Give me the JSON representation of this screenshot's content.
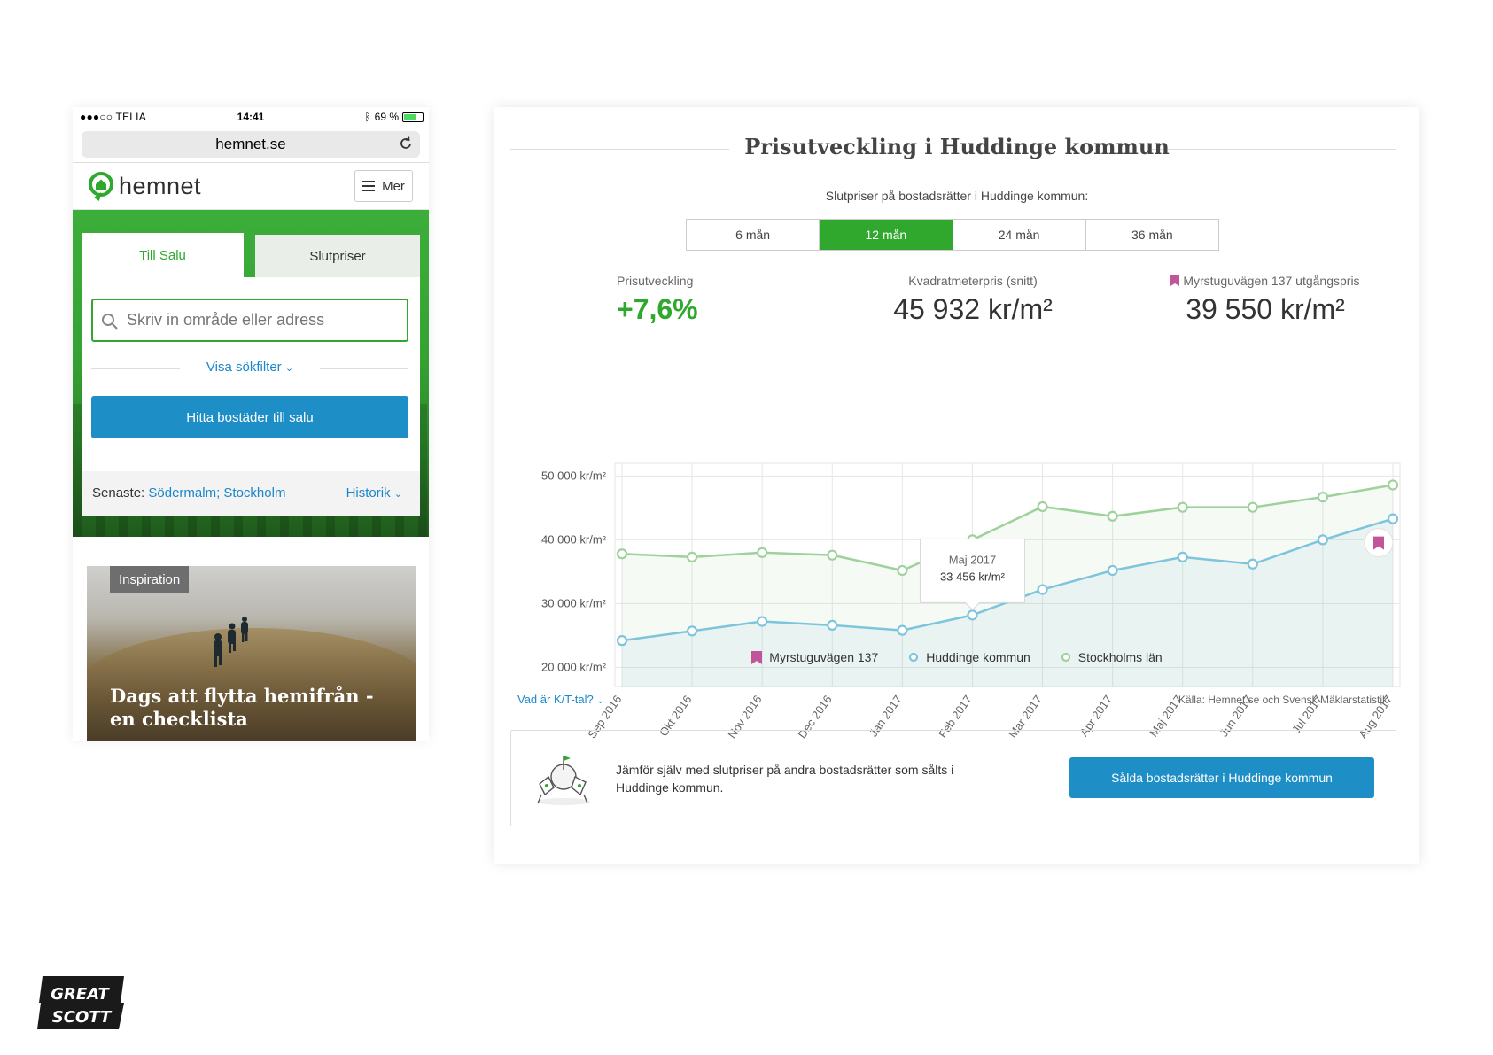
{
  "phone": {
    "status": {
      "carrier": "●●●○○ TELIA",
      "time": "14:41",
      "battery": "69 %",
      "battery_level": 0.69
    },
    "url": "hemnet.se",
    "logo_text": "hemnet",
    "menu_label": "Mer",
    "tabs": [
      {
        "label": "Till Salu"
      },
      {
        "label": "Slutpriser"
      }
    ],
    "search_placeholder": "Skriv in område eller adress",
    "filter_link": "Visa sökfilter",
    "search_button": "Hitta bostäder till salu",
    "recent": {
      "label": "Senaste:",
      "places": "Södermalm; Stockholm",
      "history": "Historik"
    },
    "inspiration": {
      "tag": "Inspiration",
      "title": "Dags att flytta hemifrån - en checklista"
    }
  },
  "widget": {
    "title": "Prisutveckling i Huddinge kommun",
    "subtitle": "Slutpriser på bostadsrätter i Huddinge kommun:",
    "periods": [
      "6 mån",
      "12 mån",
      "24 mån",
      "36 mån"
    ],
    "active_period": "12 mån",
    "stats": {
      "change": {
        "label": "Prisutveckling",
        "value": "+7,6%"
      },
      "sqm": {
        "label": "Kvadratmeterpris (snitt)",
        "value": "45 932 kr/m²"
      },
      "listing": {
        "label": "Myrstuguvägen 137 utgångspris",
        "value": "39 550 kr/m²"
      }
    },
    "legend": [
      {
        "label": "Myrstuguvägen 137",
        "color": "#c2549a"
      },
      {
        "label": "Huddinge kommun",
        "color": "#7ec4dd"
      },
      {
        "label": "Stockholms län",
        "color": "#9ed29a"
      }
    ],
    "kt_link": "Vad är K/T-tal?",
    "source": "Källa: Hemnet.se och Svensk Mäklarstatistik",
    "compare_text": "Jämför själv med slutpriser på andra bostadsrätter som sålts i Huddinge kommun.",
    "compare_button": "Sålda bostadsrätter i Huddinge kommun"
  },
  "chart_data": {
    "type": "line",
    "categories": [
      "Sep 2016",
      "Okt 2016",
      "Nov 2016",
      "Dec 2016",
      "Jan 2017",
      "Feb 2017",
      "Mar 2017",
      "Apr 2017",
      "Maj 2017",
      "Jun 2017",
      "Jul 2017",
      "Aug 2017"
    ],
    "series": [
      {
        "name": "Huddinge kommun",
        "color": "#7ec4dd",
        "values": [
          24200,
          25700,
          27200,
          26600,
          25800,
          28200,
          32200,
          35200,
          37300,
          36200,
          40000,
          43300
        ]
      },
      {
        "name": "Stockholms län",
        "color": "#9ed29a",
        "values": [
          37800,
          37300,
          38000,
          37600,
          35200,
          40000,
          45200,
          43700,
          45100,
          45100,
          46700,
          48600
        ]
      }
    ],
    "listing_marker": {
      "name": "Myrstuguvägen 137",
      "value": 39550,
      "color": "#c2549a"
    },
    "yticks": [
      {
        "value": 50000,
        "label": "50 000 kr/m²"
      },
      {
        "value": 40000,
        "label": "40 000 kr/m²"
      },
      {
        "value": 30000,
        "label": "30 000 kr/m²"
      },
      {
        "value": 20000,
        "label": "20 000 kr/m²"
      }
    ],
    "grid": true,
    "tooltip": {
      "label": "Maj 2017",
      "value": "33 456 kr/m²"
    }
  },
  "brand": {
    "line1": "GREAT",
    "line2": "SCOTT"
  }
}
